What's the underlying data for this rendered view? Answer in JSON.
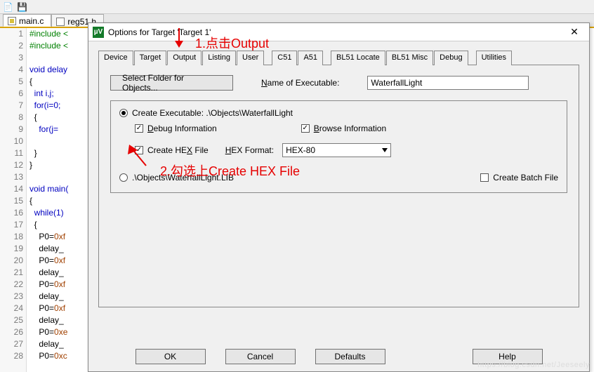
{
  "file_tabs": [
    {
      "label": "main.c",
      "active": true
    },
    {
      "label": "reg51.h",
      "active": false
    }
  ],
  "code": {
    "lines": [
      {
        "n": 1,
        "t": "#include <",
        "cls": "pp"
      },
      {
        "n": 2,
        "t": "#include <",
        "cls": "pp"
      },
      {
        "n": 3,
        "t": "",
        "cls": ""
      },
      {
        "n": 4,
        "t": "void delay",
        "cls": "kw"
      },
      {
        "n": 5,
        "t": "{",
        "cls": ""
      },
      {
        "n": 6,
        "t": "  int i,j;",
        "cls": "kw"
      },
      {
        "n": 7,
        "t": "  for(i=0;",
        "cls": "kw"
      },
      {
        "n": 8,
        "t": "  {",
        "cls": ""
      },
      {
        "n": 9,
        "t": "    for(j=",
        "cls": "kw"
      },
      {
        "n": 10,
        "t": "",
        "cls": ""
      },
      {
        "n": 11,
        "t": "  }",
        "cls": ""
      },
      {
        "n": 12,
        "t": "}",
        "cls": ""
      },
      {
        "n": 13,
        "t": "",
        "cls": ""
      },
      {
        "n": 14,
        "t": "void main(",
        "cls": "kw"
      },
      {
        "n": 15,
        "t": "{",
        "cls": ""
      },
      {
        "n": 16,
        "t": "  while(1)",
        "cls": "kw"
      },
      {
        "n": 17,
        "t": "  {",
        "cls": ""
      },
      {
        "n": 18,
        "t": "    P0=0xf",
        "cls": "num"
      },
      {
        "n": 19,
        "t": "    delay_",
        "cls": ""
      },
      {
        "n": 20,
        "t": "    P0=0xf",
        "cls": "num"
      },
      {
        "n": 21,
        "t": "    delay_",
        "cls": ""
      },
      {
        "n": 22,
        "t": "    P0=0xf",
        "cls": "num"
      },
      {
        "n": 23,
        "t": "    delay_",
        "cls": ""
      },
      {
        "n": 24,
        "t": "    P0=0xf",
        "cls": "num"
      },
      {
        "n": 25,
        "t": "    delay_",
        "cls": ""
      },
      {
        "n": 26,
        "t": "    P0=0xe",
        "cls": "num"
      },
      {
        "n": 27,
        "t": "    delay_",
        "cls": ""
      },
      {
        "n": 28,
        "t": "    P0=0xc",
        "cls": "num"
      }
    ]
  },
  "dialog": {
    "title": "Options for Target 'Target 1'",
    "tabs": [
      "Device",
      "Target",
      "Output",
      "Listing",
      "User",
      "C51",
      "A51",
      "BL51 Locate",
      "BL51 Misc",
      "Debug",
      "Utilities"
    ],
    "active_tab": "Output",
    "select_folder_btn": "Select Folder for Objects...",
    "name_of_exe_prefix": "N",
    "name_of_exe_rest": "ame of Executable:",
    "exe_name_value": "WaterfallLight",
    "create_exe_label": "Create Executable:  .\\Objects\\WaterfallLight",
    "debug_info_prefix": "D",
    "debug_info_rest": "ebug Information",
    "browse_info_prefix": "B",
    "browse_info_rest": "rowse Information",
    "create_hex_label_pre": "Create HE",
    "create_hex_label_u": "X",
    "create_hex_label_post": " File",
    "hex_format_prefix": "H",
    "hex_format_rest": "EX Format:",
    "hex_format_value": "HEX-80",
    "create_lib_label": ".\\Objects\\WaterfallLight.LIB",
    "create_batch_label": "Create Batch File",
    "buttons": {
      "ok": "OK",
      "cancel": "Cancel",
      "defaults": "Defaults",
      "help": "Help"
    }
  },
  "annotations": {
    "a1": "1.点击Output",
    "a2": "2.勾选上Create HEX File"
  },
  "watermark": "https://blog.csdn.net/Jeeseely"
}
